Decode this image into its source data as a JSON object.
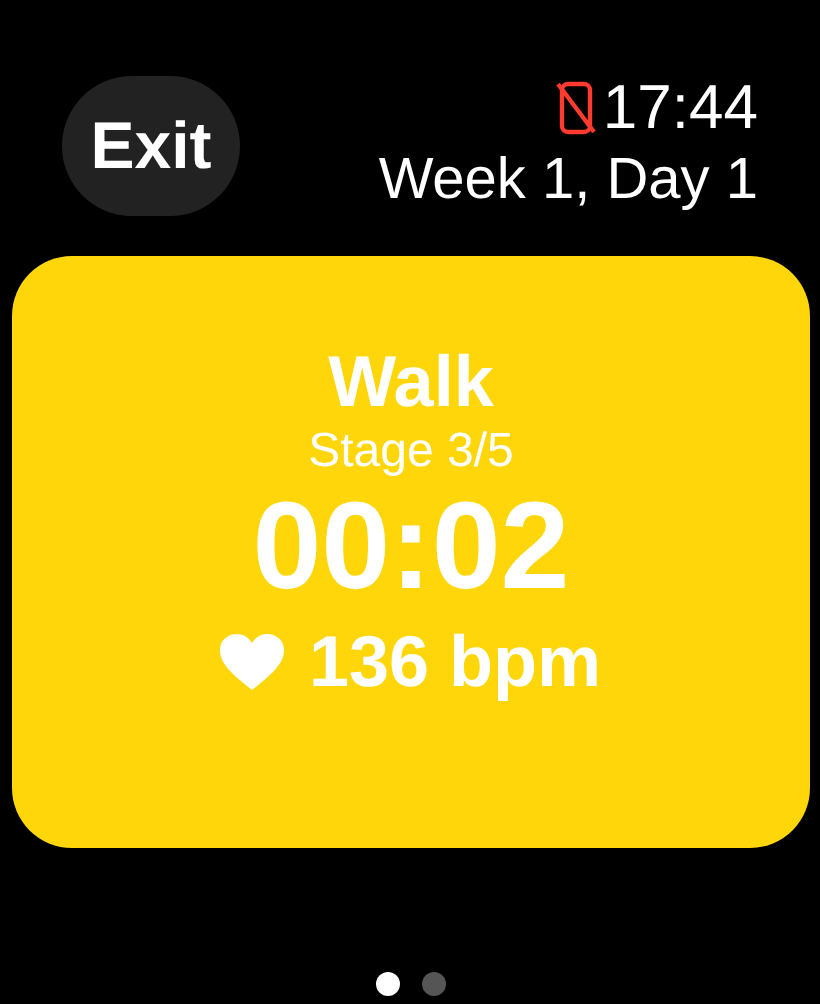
{
  "exit_button": {
    "label": "Exit"
  },
  "status": {
    "time": "17:44",
    "phone_disconnected": true
  },
  "session": {
    "label": "Week 1, Day 1"
  },
  "workout_card": {
    "activity": "Walk",
    "stage": "Stage 3/5",
    "timer": "00:02",
    "heart_rate": "136 bpm"
  },
  "pages": [
    {
      "selected": true
    },
    {
      "selected": false
    }
  ]
}
